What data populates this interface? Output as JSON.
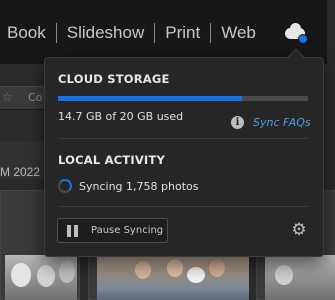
{
  "topbar": {
    "modules": [
      "Book",
      "Slideshow",
      "Print",
      "Web"
    ],
    "cloud_icon": "cloud-sync-icon"
  },
  "library": {
    "toolbar_label": "Co",
    "date_text": "M  2022"
  },
  "cloud_panel": {
    "storage_title": "CLOUD STORAGE",
    "storage_used_fraction": 0.735,
    "usage_text": "14.7 GB of 20 GB used",
    "info_icon_glyph": "i",
    "faq_link": "Sync FAQs",
    "activity_title": "LOCAL ACTIVITY",
    "syncing_text": "Syncing 1,758 photos",
    "pause_button": "Pause Syncing",
    "gear_glyph": "⚙"
  },
  "colors": {
    "accent": "#1473e6",
    "link": "#4d9de8",
    "panel_bg": "#262626"
  }
}
